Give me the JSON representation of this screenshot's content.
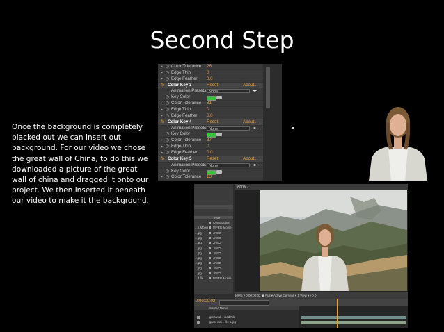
{
  "slide": {
    "title": "Second Step",
    "body": "Once the background is completely blacked out we can insert out background. For our video we chose the great wall of China, to do this we downloaded a picture of the great wall of china and dragged it onto our project. We then inserted it beneath our video to make it the background."
  },
  "effect_controls": {
    "rows": [
      {
        "kind": "prop",
        "label": "Color Tolerance",
        "value": "26"
      },
      {
        "kind": "prop",
        "label": "Edge Thin",
        "value": "0"
      },
      {
        "kind": "prop",
        "label": "Edge Feather",
        "value": "0.0"
      },
      {
        "kind": "head",
        "label": "Color Key 3",
        "reset": "Reset",
        "about": "About..."
      },
      {
        "kind": "preset",
        "label": "Animation Presets:",
        "value": "None"
      },
      {
        "kind": "color",
        "label": "Key Color"
      },
      {
        "kind": "prop",
        "label": "Color Tolerance",
        "value": "31"
      },
      {
        "kind": "prop",
        "label": "Edge Thin",
        "value": "0"
      },
      {
        "kind": "prop",
        "label": "Edge Feather",
        "value": "0.0"
      },
      {
        "kind": "head",
        "label": "Color Key 4",
        "reset": "Reset",
        "about": "About..."
      },
      {
        "kind": "preset",
        "label": "Animation Presets:",
        "value": "None"
      },
      {
        "kind": "color",
        "label": "Key Color"
      },
      {
        "kind": "prop",
        "label": "Color Tolerance",
        "value": "37"
      },
      {
        "kind": "prop",
        "label": "Edge Thin",
        "value": "0"
      },
      {
        "kind": "prop",
        "label": "Edge Feather",
        "value": "0.0"
      },
      {
        "kind": "head",
        "label": "Color Key 5",
        "reset": "Reset",
        "about": "About..."
      },
      {
        "kind": "preset",
        "label": "Animation Presets:",
        "value": "None"
      },
      {
        "kind": "color",
        "label": "Key Color"
      },
      {
        "kind": "prop",
        "label": "Color Tolerance",
        "value": "13"
      }
    ]
  },
  "ae_window": {
    "comp_label": "Anniv...",
    "project_header": "Type",
    "project_items": [
      {
        "name": "",
        "type": "Composition"
      },
      {
        "name": "...n.Mpeg",
        "type": "MPEG Movie"
      },
      {
        "name": "...jpg",
        "type": "JPEG"
      },
      {
        "name": "...jpg",
        "type": "JPEG"
      },
      {
        "name": "...jpg",
        "type": "JPEG"
      },
      {
        "name": "...jpg",
        "type": "JPEG"
      },
      {
        "name": "...jpg",
        "type": "JPEG"
      },
      {
        "name": "...jpg",
        "type": "JPEG"
      },
      {
        "name": "...jpg",
        "type": "JPEG"
      },
      {
        "name": "...jpg",
        "type": "JPEG"
      },
      {
        "name": "...jpg",
        "type": "JPEG"
      },
      {
        "name": "...d.fle",
        "type": "MPEG Movie"
      }
    ],
    "viewer_bar": "100%   ▾   0:00:00:02   ▣   Full   ▾   Active Camera   ▾   1 View   ▾   +0.0",
    "timeline_time": "0:00:00:02",
    "timeline_header": "Source Name",
    "layers": [
      "greatwal... ibad.File",
      "great wal... file 1.jpg"
    ]
  },
  "colors": {
    "background": "#000000",
    "panel": "#3a3a3a",
    "accent": "#e8a23a",
    "key_swatch": "#39c23a"
  }
}
